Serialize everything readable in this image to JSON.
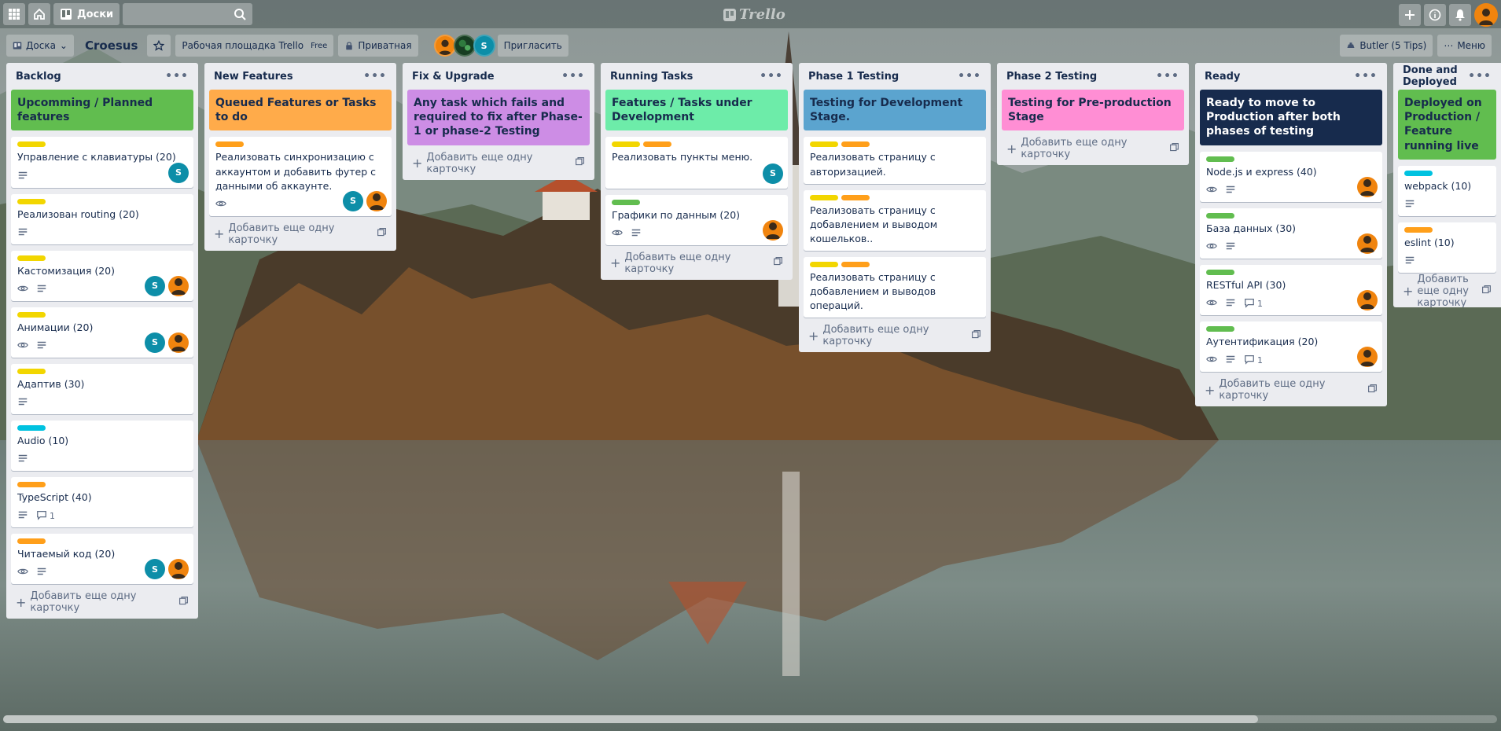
{
  "topbar": {
    "boards_label": "Доски",
    "search_placeholder": "",
    "logo_text": "Trello"
  },
  "board": {
    "switcher_label": "Доска",
    "title": "Croesus",
    "workspace_label": "Рабочая площадка Trello",
    "workspace_badge": "Free",
    "visibility_label": "Приватная",
    "invite_label": "Пригласить",
    "member_s_initial": "S",
    "butler_label": "Butler (5 Tips)",
    "menu_label": "Меню"
  },
  "add_card_label": "Добавить еще одну карточку",
  "lists": [
    {
      "title": "Backlog",
      "cover": {
        "text": "Upcomming / Planned features",
        "color": "#61bd4f"
      },
      "cards": [
        {
          "title": "Управление с клавиатуры (20)",
          "labels": [
            "#f2d600"
          ],
          "badges": {
            "desc": true
          },
          "members": [
            "S"
          ]
        },
        {
          "title": "Реализован routing (20)",
          "labels": [
            "#f2d600"
          ],
          "badges": {
            "desc": true
          },
          "members": []
        },
        {
          "title": "Кастомизация (20)",
          "labels": [
            "#f2d600"
          ],
          "badges": {
            "watch": true,
            "desc": true
          },
          "members": [
            "S",
            "O"
          ]
        },
        {
          "title": "Анимации (20)",
          "labels": [
            "#f2d600"
          ],
          "badges": {
            "watch": true,
            "desc": true
          },
          "members": [
            "S",
            "O"
          ]
        },
        {
          "title": "Адаптив (30)",
          "labels": [
            "#f2d600"
          ],
          "badges": {
            "desc": true
          },
          "members": []
        },
        {
          "title": "Audio (10)",
          "labels": [
            "#00c2e0"
          ],
          "badges": {
            "desc": true
          },
          "members": []
        },
        {
          "title": "TypeScript (40)",
          "labels": [
            "#ff9f1a"
          ],
          "badges": {
            "desc": true,
            "comments": "1"
          },
          "members": []
        },
        {
          "title": "Читаемый код (20)",
          "labels": [
            "#ff9f1a"
          ],
          "badges": {
            "watch": true,
            "desc": true
          },
          "members": [
            "S",
            "O"
          ]
        }
      ]
    },
    {
      "title": "New Features",
      "cover": {
        "text": "Queued Features or Tasks to do",
        "color": "#ffab4a"
      },
      "cards": [
        {
          "title": "Реализовать синхронизацию с аккаунтом и добавить футер с данными об аккаунте.",
          "labels": [
            "#ff9f1a"
          ],
          "badges": {
            "watch": true
          },
          "members": [
            "S",
            "O"
          ]
        }
      ]
    },
    {
      "title": "Fix & Upgrade",
      "cover": {
        "text": "Any task which fails and required to fix after Phase-1 or phase-2 Testing",
        "color": "#cd8de5"
      },
      "cards": []
    },
    {
      "title": "Running Tasks",
      "cover": {
        "text": "Features / Tasks under Development",
        "color": "#6deca9"
      },
      "cards": [
        {
          "title": "Реализовать пункты меню.",
          "labels": [
            "#f2d600",
            "#ff9f1a"
          ],
          "badges": {},
          "members": [
            "S"
          ]
        },
        {
          "title": "Графики по данным (20)",
          "labels": [
            "#61bd4f"
          ],
          "badges": {
            "watch": true,
            "desc": true
          },
          "members": [
            "O"
          ]
        }
      ]
    },
    {
      "title": "Phase 1 Testing",
      "cover": {
        "text": "Testing for Development Stage.",
        "color": "#5ba4cf"
      },
      "cards": [
        {
          "title": "Реализовать страницу с авторизацией.",
          "labels": [
            "#f2d600",
            "#ff9f1a"
          ],
          "badges": {},
          "members": []
        },
        {
          "title": "Реализовать страницу с добавлением и выводом кошельков..",
          "labels": [
            "#f2d600",
            "#ff9f1a"
          ],
          "badges": {},
          "members": []
        },
        {
          "title": "Реализовать страницу с добавлением и выводов операций.",
          "labels": [
            "#f2d600",
            "#ff9f1a"
          ],
          "badges": {},
          "members": []
        }
      ]
    },
    {
      "title": "Phase 2 Testing",
      "cover": {
        "text": "Testing for Pre-production Stage",
        "color": "#ff8ed4"
      },
      "cards": []
    },
    {
      "title": "Ready",
      "cover": {
        "text": "Ready to move to Production after both phases of testing",
        "color": "#172b4d",
        "dark": true
      },
      "cards": [
        {
          "title": "Node.js и express (40)",
          "labels": [
            "#61bd4f"
          ],
          "badges": {
            "watch": true,
            "desc": true
          },
          "members": [
            "O"
          ]
        },
        {
          "title": "База данных (30)",
          "labels": [
            "#61bd4f"
          ],
          "badges": {
            "watch": true,
            "desc": true
          },
          "members": [
            "O"
          ]
        },
        {
          "title": "RESTful API (30)",
          "labels": [
            "#61bd4f"
          ],
          "badges": {
            "watch": true,
            "desc": true,
            "comments": "1"
          },
          "members": [
            "O"
          ]
        },
        {
          "title": "Аутентификация (20)",
          "labels": [
            "#61bd4f"
          ],
          "badges": {
            "watch": true,
            "desc": true,
            "comments": "1"
          },
          "members": [
            "O"
          ]
        }
      ]
    },
    {
      "title": "Done and Deployed",
      "cover": {
        "text": "Deployed on Production / Feature running live",
        "color": "#61bd4f"
      },
      "cards": [
        {
          "title": "webpack (10)",
          "labels": [
            "#00c2e0"
          ],
          "badges": {
            "desc": true
          },
          "members": []
        },
        {
          "title": "eslint (10)",
          "labels": [
            "#ff9f1a"
          ],
          "badges": {
            "desc": true
          },
          "members": []
        }
      ]
    }
  ]
}
